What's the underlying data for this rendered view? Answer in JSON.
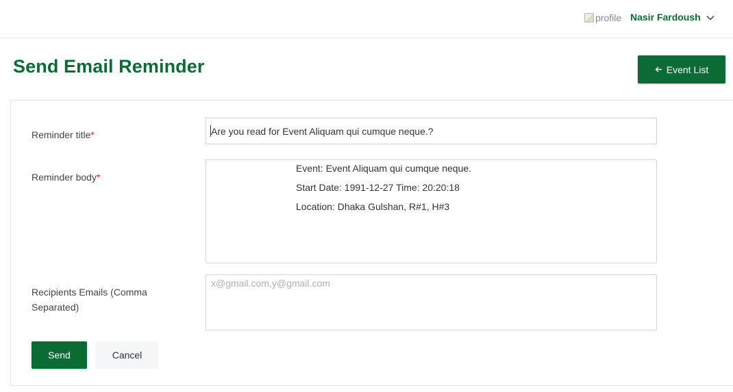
{
  "header": {
    "profile_alt": "profile",
    "user_name": "Nasir Fardoush",
    "menu_icon": "chevron-down-icon"
  },
  "page": {
    "title": "Send Email Reminder",
    "event_list_label": "Event List",
    "event_list_icon": "arrow-left-icon"
  },
  "form": {
    "title_label": "Reminder title",
    "title_value": "Are you read for Event Aliquam qui cumque neque.?",
    "body_label": "Reminder body",
    "body_lines": [
      "Event: Event Aliquam qui cumque neque.",
      "Start Date: 1991-12-27 Time: 20:20:18",
      "Location: Dhaka Gulshan, R#1, H#3"
    ],
    "recipients_label_line1": "Recipients Emails (Comma",
    "recipients_label_line2": "Separated)",
    "recipients_placeholder": "x@gmail.com,y@gmail.com",
    "recipients_value": "",
    "required_marker": "*",
    "send_label": "Send",
    "cancel_label": "Cancel"
  },
  "colors": {
    "brand": "#0b6b35",
    "required": "#c62828"
  }
}
